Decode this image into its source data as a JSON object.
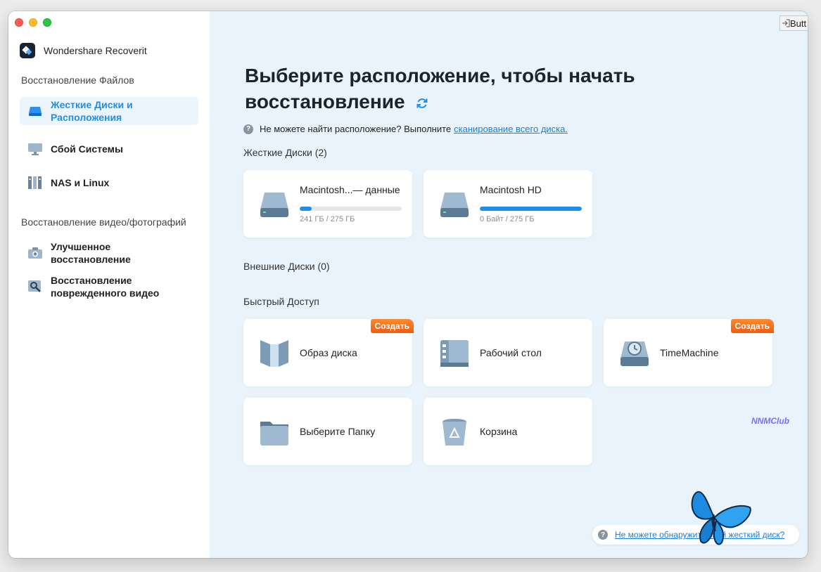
{
  "app": {
    "name": "Wondershare Recoverit"
  },
  "sidebar": {
    "file_recovery_label": "Восстановление Файлов",
    "items": [
      {
        "label": "Жесткие Диски и\nРасположения",
        "icon": "hard-drive-icon",
        "active": true
      },
      {
        "label": "Сбой Системы",
        "icon": "monitor-icon"
      },
      {
        "label": "NAS и Linux",
        "icon": "nas-icon"
      }
    ],
    "media_recovery_label": "Восстановление видео/фотографий",
    "media_items": [
      {
        "label": "Улучшенное\nвосстановление",
        "icon": "camera-icon"
      },
      {
        "label": "Восстановление\nповрежденного видео",
        "icon": "video-repair-icon"
      }
    ]
  },
  "main": {
    "title": "Выберите расположение, чтобы начать восстановление",
    "hint_text": "Не можете найти расположение? Выполните",
    "hint_link": "сканирование всего диска.",
    "hard_drives_label": "Жесткие Диски (2)",
    "drives": [
      {
        "name": "Macintosh...— данные",
        "size": "241 ГБ / 275 ГБ",
        "usage": 0.12
      },
      {
        "name": "Macintosh HD",
        "size": "0 Байт / 275 ГБ",
        "usage": 1.0
      }
    ],
    "external_label": "Внешние Диски (0)",
    "quick_access_label": "Быстрый Доступ",
    "quick": [
      {
        "label": "Образ диска",
        "icon": "disk-image-icon",
        "badge": "Создать"
      },
      {
        "label": "Рабочий стол",
        "icon": "desktop-icon"
      },
      {
        "label": "TimeMachine",
        "icon": "time-machine-icon",
        "badge": "Создать"
      },
      {
        "label": "Выберите Папку",
        "icon": "folder-icon"
      },
      {
        "label": "Корзина",
        "icon": "trash-icon"
      }
    ],
    "watermark": "NNMClub",
    "corner_button": "Butt",
    "help_link": "Не можете обнаружить свой жесткий диск?"
  },
  "colors": {
    "accent": "#1f8ee8",
    "badge": "#f05a14",
    "main_bg": "#e8f3fb"
  }
}
